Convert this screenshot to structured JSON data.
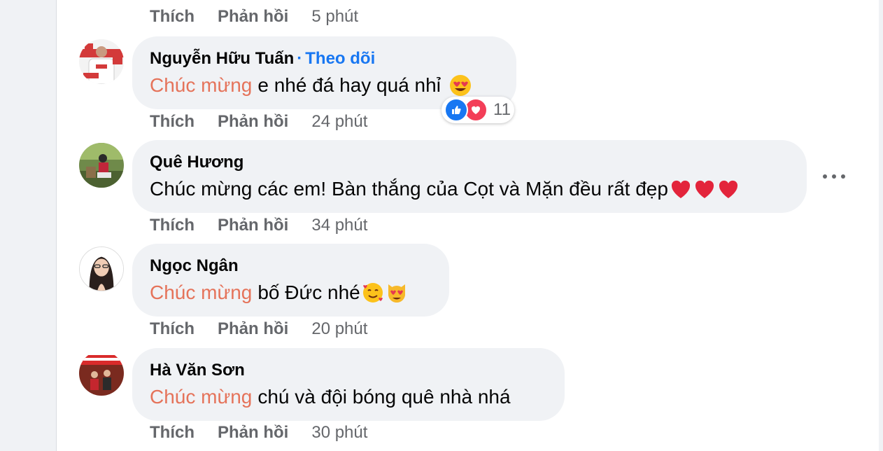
{
  "labels": {
    "like": "Thích",
    "reply": "Phản hồi"
  },
  "top_actions": {
    "time": "5 phút"
  },
  "comments": [
    {
      "author": "Nguyễn Hữu Tuấn",
      "follow": "Theo dõi",
      "highlight": "Chúc mừng",
      "text": "e nhé đá hay quá nhỉ",
      "emojis": [
        "heart-eyes"
      ],
      "time": "24 phút",
      "reactions": {
        "types": [
          "like",
          "love"
        ],
        "count": "11"
      }
    },
    {
      "author": "Quê Hương",
      "text": "Chúc mừng các em! Bàn thắng của Cọt và Mặn đều rất đẹp",
      "emojis": [
        "red-heart",
        "red-heart",
        "red-heart"
      ],
      "time": "34 phút"
    },
    {
      "author": "Ngọc Ngân",
      "highlight": "Chúc mừng",
      "text": "bố Đức nhé",
      "emojis": [
        "smiling-face-with-hearts",
        "heart-eyes-cat"
      ],
      "time": "20 phút"
    },
    {
      "author": "Hà Văn Sơn",
      "highlight": "Chúc mừng",
      "text": "chú và đội bóng quê nhà nhá",
      "emojis": [],
      "time": "30 phút"
    }
  ],
  "colors": {
    "highlight": "#e5735a",
    "link": "#1877f2",
    "bubble": "#f0f2f5",
    "meta": "#65676b"
  }
}
